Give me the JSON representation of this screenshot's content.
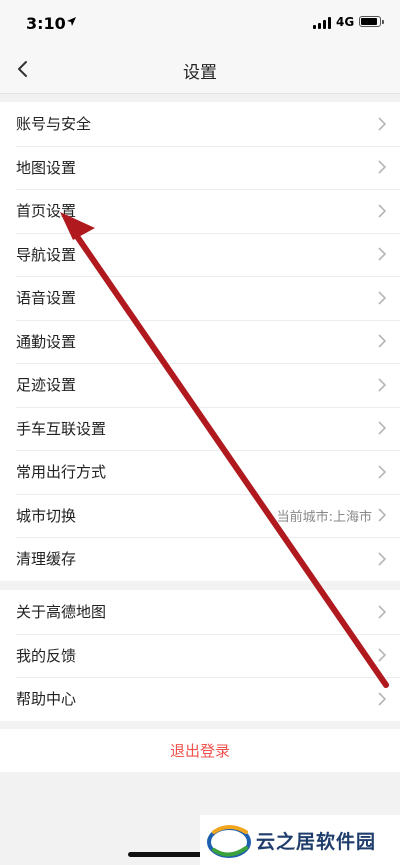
{
  "status_bar": {
    "time": "3:10",
    "network": "4G"
  },
  "nav": {
    "title": "设置"
  },
  "groups": [
    {
      "items": [
        {
          "label": "账号与安全"
        },
        {
          "label": "地图设置"
        },
        {
          "label": "首页设置"
        },
        {
          "label": "导航设置"
        },
        {
          "label": "语音设置"
        },
        {
          "label": "通勤设置"
        },
        {
          "label": "足迹设置"
        },
        {
          "label": "手车互联设置"
        },
        {
          "label": "常用出行方式"
        },
        {
          "label": "城市切换",
          "value": "当前城市:上海市"
        },
        {
          "label": "清理缓存"
        }
      ]
    },
    {
      "items": [
        {
          "label": "关于高德地图"
        },
        {
          "label": "我的反馈"
        },
        {
          "label": "帮助中心"
        }
      ]
    }
  ],
  "logout": {
    "label": "退出登录"
  },
  "watermark": {
    "text": "云之居软件园"
  },
  "colors": {
    "accent_red": "#f0524d",
    "annotation_arrow": "#b0191e"
  }
}
